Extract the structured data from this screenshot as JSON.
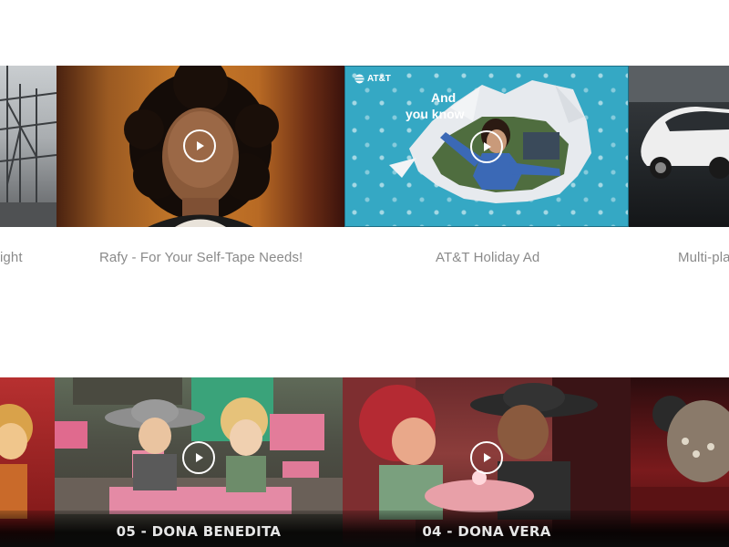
{
  "row1": {
    "tiles": [
      {
        "caption": "ight",
        "has_play": false
      },
      {
        "caption": "Rafy - For Your Self-Tape Needs!",
        "has_play": true
      },
      {
        "caption": "AT&T Holiday Ad",
        "has_play": true,
        "brand": "AT&T",
        "overlay_text": [
          "And",
          "you know"
        ]
      },
      {
        "caption": "Multi-pla",
        "has_play": false
      }
    ]
  },
  "row2": {
    "tiles": [
      {
        "title": "",
        "has_play": false
      },
      {
        "title": "05 - DONA BENEDITA",
        "has_play": true
      },
      {
        "title": "04 - DONA VERA",
        "has_play": true
      },
      {
        "title": "",
        "has_play": false
      }
    ]
  },
  "colors": {
    "att_blue": "#35a8c4",
    "caption_gray": "#8a8a8a",
    "play_icon": "#ffffff"
  }
}
